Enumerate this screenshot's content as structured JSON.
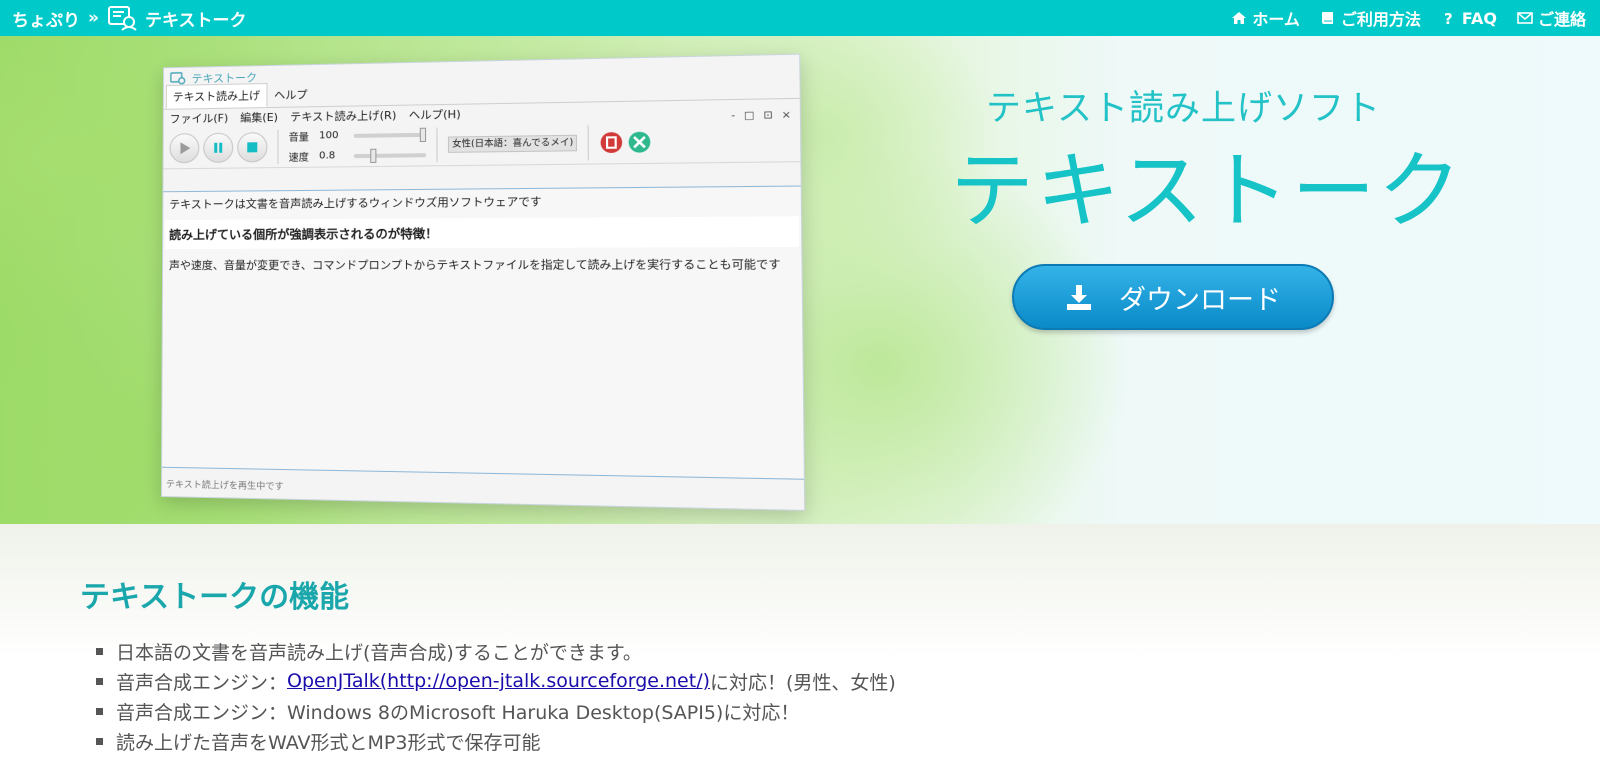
{
  "topbar": {
    "brand": "ちょぷり",
    "separator": "»",
    "app_name": "テキストーク",
    "nav": [
      {
        "label": "ホーム",
        "icon": "home-icon"
      },
      {
        "label": "ご利用方法",
        "icon": "book-icon"
      },
      {
        "label": "FAQ",
        "icon": "question-icon"
      },
      {
        "label": "ご連絡",
        "icon": "mail-icon"
      }
    ]
  },
  "app_mock": {
    "title": "テキストーク",
    "tabs": [
      "テキスト読み上げ",
      "ヘルプ"
    ],
    "window_controls": [
      "-",
      "□",
      "⊡",
      "×"
    ],
    "menu": [
      "ファイル(F)",
      "編集(E)",
      "テキスト読み上げ(R)",
      "ヘルプ(H)"
    ],
    "volume_label": "音量",
    "volume_value": "100",
    "speed_label": "速度",
    "speed_value": "0.8",
    "volume_level": 1.0,
    "speed_level": 0.25,
    "voice": "女性(日本語：喜んでるメイ) [Op",
    "line1": "テキストークは文書を音声読み上げするウィンドウズ用ソフトウェアです",
    "line2": "読み上げている個所が強調表示されるのが特徴！",
    "line3": "声や速度、音量が変更でき、コマンドプロンプトからテキストファイルを指定して読み上げを実行することも可能です",
    "status": "テキスト読上げを再生中です"
  },
  "hero": {
    "subtitle": "テキスト読み上げソフト",
    "title": "テキストーク",
    "download_label": "ダウンロード"
  },
  "features": {
    "heading": "テキストークの機能",
    "item1": "日本語の文書を音声読み上げ(音声合成)することができます。",
    "item2_prefix": "音声合成エンジン：",
    "item2_link": "OpenJTalk(http://open-jtalk.sourceforge.net/)",
    "item2_suffix": "に対応！(男性、女性)",
    "item3": "音声合成エンジン：Windows 8のMicrosoft Haruka Desktop(SAPI5)に対応！",
    "item4": "読み上げた音声をWAV形式とMP3形式で保存可能"
  },
  "colors": {
    "topbar": "#00c9c9",
    "accent": "#16c3c6",
    "download": "#1a9fd8",
    "heading": "#19a7ab"
  }
}
